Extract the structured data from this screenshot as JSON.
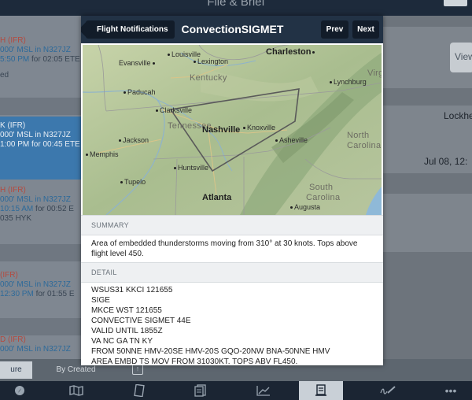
{
  "app": {
    "title": "File & Brief",
    "list_rows": [
      {
        "line1_prefix": "H",
        "line1_tag": "(IFR)",
        "line2": "000' MSL in N327JZ",
        "line3_time": "5:50 PM",
        "line3_rest": " for 02:05 ETE",
        "line4": "ed"
      },
      {
        "line1_prefix": "K",
        "line1_tag": "(IFR)",
        "line2": "000' MSL in N327JZ",
        "line3_time": "1:00 PM",
        "line3_rest": " for 00:45 ETE",
        "line4": ""
      },
      {
        "line1_prefix": "H",
        "line1_tag": "(IFR)",
        "line2": "000' MSL in N327JZ",
        "line3_time": "10:15 AM",
        "line3_rest": " for 00:52 E",
        "line4": "035 HYK"
      },
      {
        "line1_prefix": "",
        "line1_tag": "(IFR)",
        "line2": "000' MSL in N327JZ",
        "line3_time": "12:30 PM",
        "line3_rest": " for 01:55 E",
        "line4": ""
      },
      {
        "line1_prefix": "D",
        "line1_tag": "(IFR)",
        "line2": "000' MSL in N327JZ",
        "line3_time": "",
        "line3_rest": "",
        "line4": ""
      }
    ],
    "right_pane": {
      "view_label": "View",
      "name": "Lockhe",
      "date": "Jul 08, 12:"
    },
    "segments": {
      "left": "ure",
      "right": "By Created"
    }
  },
  "modal": {
    "back_label": "Flight Notifications",
    "title": "ConvectionSIGMET",
    "prev_label": "Prev",
    "next_label": "Next",
    "map": {
      "states": {
        "kentucky": "Kentucky",
        "tennessee": "Tennessee",
        "north_carolina_1": "North",
        "north_carolina_2": "Carolina",
        "south_carolina_1": "South",
        "south_carolina_2": "Carolina",
        "virginia": "Virg"
      },
      "cities": {
        "louisville": "Louisville",
        "charleston": "Charleston",
        "evansville": "Evansville",
        "lexington": "Lexington",
        "lynchburg": "Lynchburg",
        "paducah": "Paducah",
        "clarksville": "Clarksville",
        "nashville": "Nashville",
        "knoxville": "Knoxville",
        "jackson": "Jackson",
        "asheville": "Asheville",
        "memphis": "Memphis",
        "huntsville": "Huntsville",
        "tupelo": "Tupelo",
        "atlanta": "Atlanta",
        "augusta": "Augusta"
      },
      "sigmet_polygon_color": "#5a5a5a"
    },
    "summary_label": "SUMMARY",
    "summary_text": "Area of embedded thunderstorms moving from 310° at 30 knots. Tops above flight level 450.",
    "detail_label": "DETAIL",
    "detail_text": "WSUS31 KKCI 121655\nSIGE\nMKCE WST 121655\nCONVECTIVE SIGMET 44E\nVALID UNTIL 1855Z\nVA NC GA TN KY\nFROM 50NNE HMV-20SE HMV-20S GQO-20NW BNA-50NNE HMV\nAREA EMBD TS MOV FROM 31030KT. TOPS ABV FL450."
  },
  "bottom_bar": {
    "items": [
      "compass-icon",
      "map-icon",
      "plates-icon",
      "documents-icon",
      "chart-icon",
      "file-brief-icon",
      "logbook-icon",
      "more-icon"
    ],
    "selected": "file-brief-icon",
    "more_label": "•••"
  }
}
